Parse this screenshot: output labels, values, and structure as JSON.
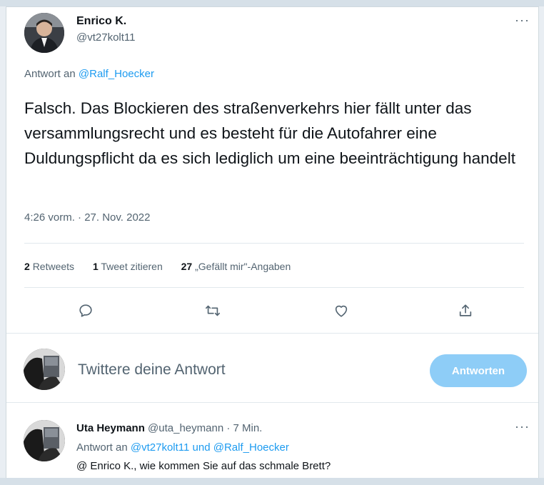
{
  "tweet": {
    "author_name": "Enrico K.",
    "author_handle": "@vt27kolt11",
    "more_label": "···",
    "reply_prefix": "Antwort an",
    "reply_target": "@Ralf_Hoecker",
    "text": "Falsch. Das Blockieren des straßenverkehrs hier fällt unter das versammlungsrecht und es besteht für die Autofahrer eine Duldungspflicht da es sich lediglich um eine beeinträchtigung handelt",
    "timestamp": "4:26 vorm. · 27. Nov. 2022"
  },
  "stats": {
    "retweets_count": "2",
    "retweets_label": "Retweets",
    "quotes_count": "1",
    "quotes_label": "Tweet zitieren",
    "likes_count": "27",
    "likes_label": "„Gefällt mir\"-Angaben"
  },
  "actions": {
    "icons": [
      "reply-icon",
      "retweet-icon",
      "like-icon",
      "share-icon"
    ]
  },
  "compose": {
    "placeholder": "Twittere deine Antwort",
    "button_label": "Antworten"
  },
  "reply": {
    "author_name": "Uta Heymann",
    "author_handle": "@uta_heymann",
    "time": "· 7 Min.",
    "more_label": "···",
    "reply_prefix": "Antwort an",
    "reply_targets": "@vt27kolt11 und @Ralf_Hoecker",
    "text": "@ Enrico K., wie kommen Sie auf das schmale Brett?"
  },
  "colors": {
    "accent": "#1d9bf0",
    "button_disabled": "#8ecdf7",
    "secondary_text": "#536471"
  }
}
